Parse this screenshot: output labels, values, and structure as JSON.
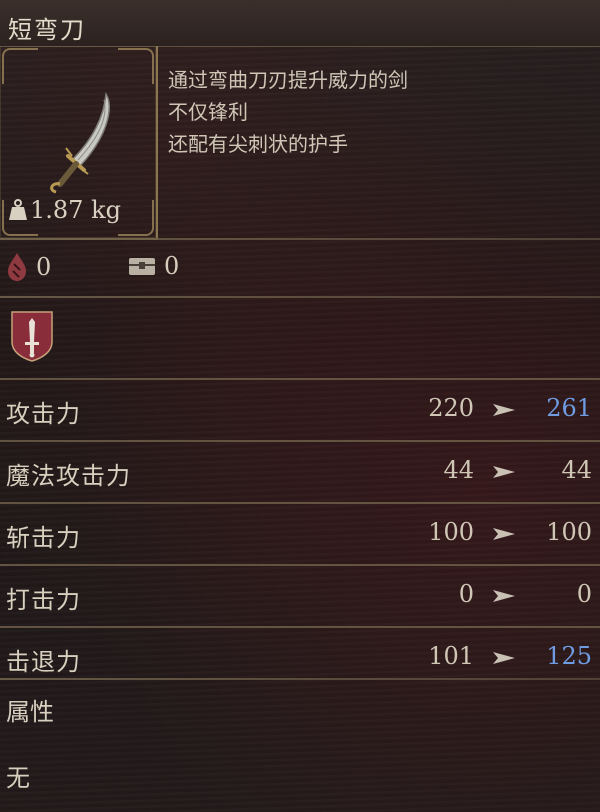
{
  "item": {
    "name": "短弯刀",
    "weight": "1.87 kg",
    "description": [
      "通过弯曲刀刃提升威力的剑",
      "不仅锋利",
      "还配有尖刺状的护手"
    ],
    "icon": "curved-sword-icon"
  },
  "counters": [
    {
      "icon": "blood-drop-icon",
      "value": "0"
    },
    {
      "icon": "chest-icon",
      "value": "0"
    }
  ],
  "affinity_icon": "sword-shield-icon",
  "stats": [
    {
      "label": "攻击力",
      "base": "220",
      "upgraded": "261",
      "improved": true
    },
    {
      "label": "魔法攻击力",
      "base": "44",
      "upgraded": "44",
      "improved": false
    },
    {
      "label": "斩击力",
      "base": "100",
      "upgraded": "100",
      "improved": false
    },
    {
      "label": "打击力",
      "base": "0",
      "upgraded": "0",
      "improved": false
    },
    {
      "label": "击退力",
      "base": "101",
      "upgraded": "125",
      "improved": true
    }
  ],
  "attribute": {
    "label": "属性",
    "value": "无"
  },
  "colors": {
    "improved": "#6f9be0",
    "text": "#cfc6b6",
    "frame": "#8a7650"
  }
}
